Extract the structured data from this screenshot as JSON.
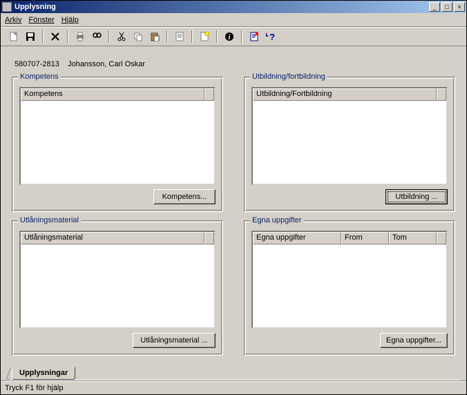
{
  "window": {
    "title": "Upplysning"
  },
  "menu": {
    "arkiv": "Arkiv",
    "fonster": "Fönster",
    "hjalp": "Hjälp"
  },
  "person": {
    "id": "580707-2813",
    "name": "Johansson, Carl Oskar"
  },
  "panels": {
    "kompetens": {
      "legend": "Kompetens",
      "col": "Kompetens",
      "button": "Kompetens..."
    },
    "utbildning": {
      "legend": "Utbildning/fortbildning",
      "col": "Utbildning/Fortbildning",
      "button": "Utbildning ..."
    },
    "utlaning": {
      "legend": "Utlåningsmaterial",
      "col": "Utlåningsmaterial",
      "button": "Utlåningsmaterial ..."
    },
    "egna": {
      "legend": "Egna uppgifter",
      "col1": "Egna uppgifter",
      "col2": "From",
      "col3": "Tom",
      "button": "Egna uppgifter..."
    }
  },
  "tab": {
    "label": "Upplysningar"
  },
  "status": {
    "text": "Tryck F1 för hjälp"
  }
}
